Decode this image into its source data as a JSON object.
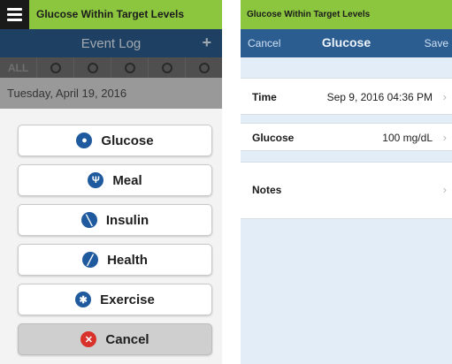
{
  "left": {
    "banner": {
      "title": "Glucose Within Target Levels",
      "menu_icon": "hamburger-menu-icon"
    },
    "event_log": {
      "title": "Event Log",
      "add_label": "+",
      "filters": [
        {
          "label": "ALL"
        },
        {
          "icon": "glucose-drop-icon"
        },
        {
          "icon": "meal-icon"
        },
        {
          "icon": "insulin-icon"
        },
        {
          "icon": "health-icon"
        },
        {
          "icon": "exercise-icon"
        }
      ],
      "date": "Tuesday, April 19, 2016"
    },
    "action_sheet": {
      "options": [
        {
          "label": "Glucose",
          "icon": "glucose-drop-icon"
        },
        {
          "label": "Meal",
          "icon": "meal-icon"
        },
        {
          "label": "Insulin",
          "icon": "insulin-icon"
        },
        {
          "label": "Health",
          "icon": "health-icon"
        },
        {
          "label": "Exercise",
          "icon": "exercise-icon"
        }
      ],
      "cancel": {
        "label": "Cancel",
        "icon": "cancel-x-icon"
      }
    }
  },
  "right": {
    "banner": {
      "title": "Glucose Within Target Levels"
    },
    "nav": {
      "cancel": "Cancel",
      "title": "Glucose",
      "save": "Save"
    },
    "rows": [
      {
        "label": "Time",
        "value": "Sep 9, 2016 04:36 PM"
      },
      {
        "label": "Glucose",
        "value": "100 mg/dL"
      },
      {
        "label": "Notes",
        "value": ""
      }
    ]
  },
  "colors": {
    "banner_green": "#8cc63f",
    "nav_blue": "#2c5d91",
    "icon_blue": "#1f5a9e",
    "cancel_red": "#d9312b",
    "form_background": "#e3edf7"
  }
}
